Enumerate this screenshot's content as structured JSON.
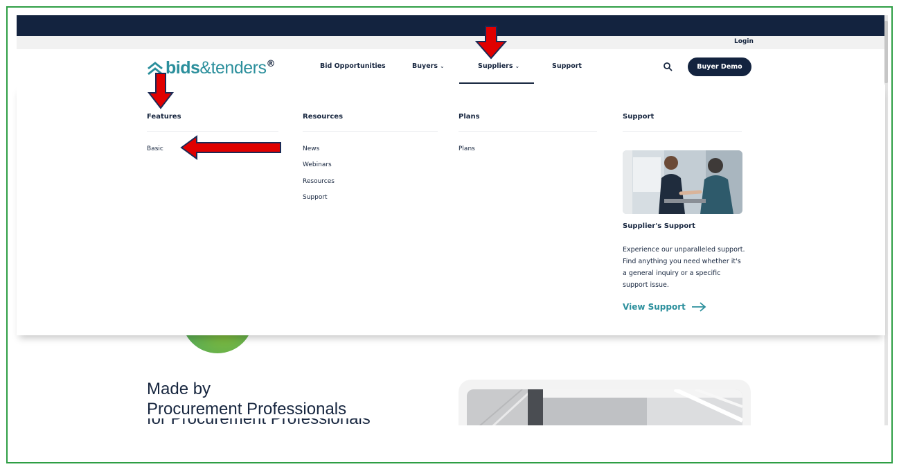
{
  "header": {
    "login_label": "Login",
    "logo": {
      "bold": "bids",
      "light": "&tenders",
      "mark": "®"
    },
    "nav": [
      {
        "label": "Bid Opportunities",
        "has_dropdown": false
      },
      {
        "label": "Buyers",
        "has_dropdown": true
      },
      {
        "label": "Suppliers",
        "has_dropdown": true,
        "active": true
      },
      {
        "label": "Support",
        "has_dropdown": false
      }
    ],
    "search_icon": "search-icon",
    "demo_button": "Buyer Demo"
  },
  "mega_menu": {
    "features": {
      "heading": "Features",
      "links": [
        "Basic"
      ]
    },
    "resources": {
      "heading": "Resources",
      "links": [
        "News",
        "Webinars",
        "Resources",
        "Support"
      ]
    },
    "plans": {
      "heading": "Plans",
      "links": [
        "Plans"
      ]
    },
    "support": {
      "heading": "Support",
      "card_title": "Supplier's Support",
      "card_description": "Experience our unparalleled support. Find anything you need whether it's a general inquiry or a specific support issue.",
      "cta": "View Support"
    }
  },
  "hero": {
    "line1": "Made by",
    "line2": "Procurement Professionals",
    "line3": "for Procurement Professionals"
  },
  "colors": {
    "navy": "#13233f",
    "teal": "#2b8f9c",
    "annotation_red": "#e00000",
    "frame_green": "#2e9e44"
  }
}
